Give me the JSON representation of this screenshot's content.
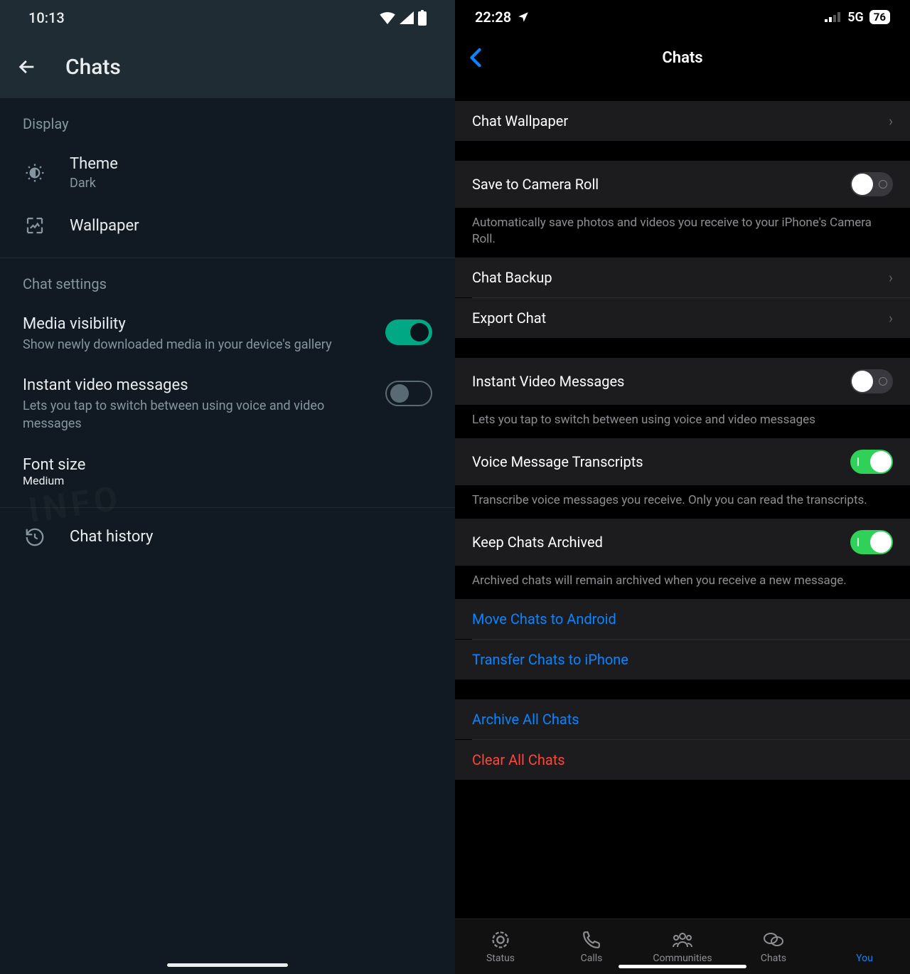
{
  "left": {
    "status_time": "10:13",
    "appbar_title": "Chats",
    "section_display": "Display",
    "theme": {
      "label": "Theme",
      "value": "Dark"
    },
    "wallpaper_label": "Wallpaper",
    "section_chat_settings": "Chat settings",
    "media_visibility": {
      "label": "Media visibility",
      "desc": "Show newly downloaded media in your device's gallery",
      "on": true
    },
    "instant_video": {
      "label": "Instant video messages",
      "desc": "Lets you tap to switch between using voice and video messages",
      "on": false
    },
    "font_size": {
      "label": "Font size",
      "value": "Medium"
    },
    "chat_history_label": "Chat history"
  },
  "right": {
    "status_time": "22:28",
    "network": "5G",
    "battery": "76",
    "nav_title": "Chats",
    "chat_wallpaper": "Chat Wallpaper",
    "save_camera_roll": {
      "label": "Save to Camera Roll",
      "on": false
    },
    "save_camera_roll_desc": "Automatically save photos and videos you receive to your iPhone's Camera Roll.",
    "chat_backup": "Chat Backup",
    "export_chat": "Export Chat",
    "instant_video": {
      "label": "Instant Video Messages",
      "on": false
    },
    "instant_video_desc": "Lets you tap to switch between using voice and video messages",
    "voice_transcripts": {
      "label": "Voice Message Transcripts",
      "on": true
    },
    "voice_transcripts_desc": "Transcribe voice messages you receive. Only you can read the transcripts.",
    "keep_archived": {
      "label": "Keep Chats Archived",
      "on": true
    },
    "keep_archived_desc": "Archived chats will remain archived when you receive a new message.",
    "move_android": "Move Chats to Android",
    "transfer_iphone": "Transfer Chats to iPhone",
    "archive_all": "Archive All Chats",
    "clear_all": "Clear All Chats",
    "tabs": {
      "status": "Status",
      "calls": "Calls",
      "communities": "Communities",
      "chats": "Chats",
      "you": "You"
    }
  }
}
